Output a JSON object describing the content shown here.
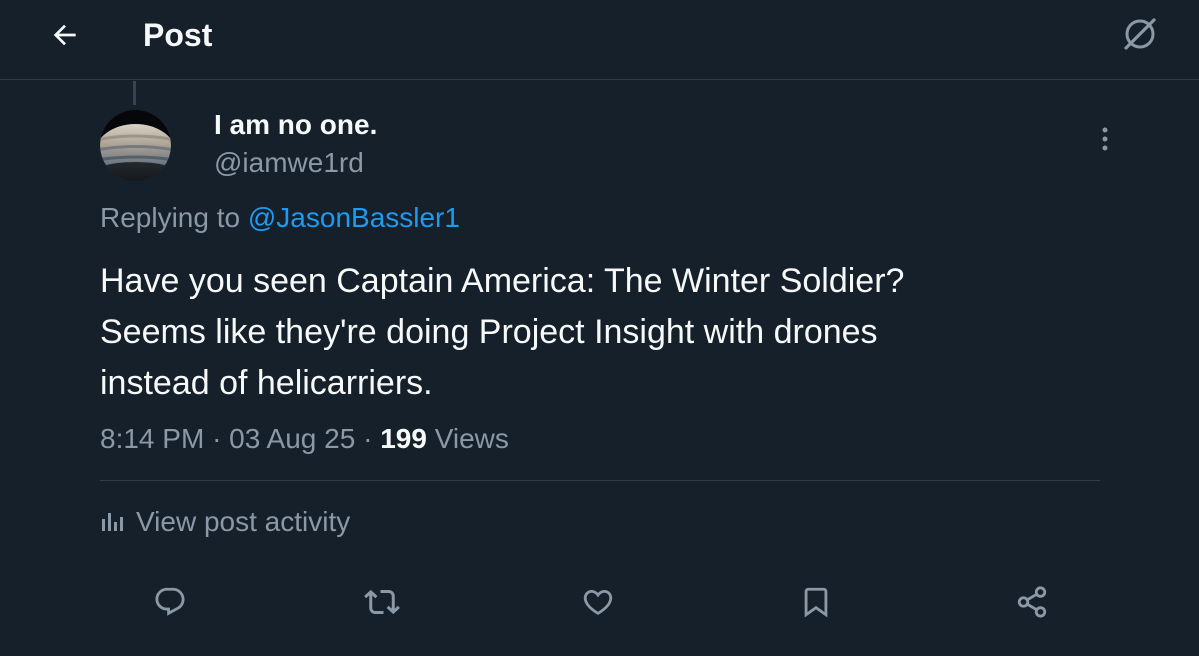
{
  "header": {
    "title": "Post",
    "back_icon": "arrow-left-icon",
    "grok_icon": "grok-icon"
  },
  "author": {
    "name": "I am no one.",
    "handle": "@iamwe1rd",
    "avatar_icon": "planet-avatar"
  },
  "reply_context": {
    "prefix": "Replying to",
    "mention": "@JasonBassler1"
  },
  "post": {
    "line1": "Have you seen Captain America: The Winter Soldier?",
    "line2": "Seems like they're doing Project Insight with drones",
    "line3": "instead of helicarriers."
  },
  "meta": {
    "time": "8:14 PM",
    "date": "03 Aug 25",
    "separator": "·",
    "views_count": "199",
    "views_label": "Views"
  },
  "activity": {
    "label": "View post activity",
    "icon": "bar-chart-icon"
  },
  "actions": [
    {
      "name": "reply",
      "icon": "reply-icon"
    },
    {
      "name": "repost",
      "icon": "repost-icon"
    },
    {
      "name": "like",
      "icon": "heart-icon"
    },
    {
      "name": "bookmark",
      "icon": "bookmark-icon"
    },
    {
      "name": "share",
      "icon": "share-icon"
    }
  ],
  "colors": {
    "background": "#15202b",
    "primary_text": "#f7f9f9",
    "secondary_text": "#8b98a5",
    "accent": "#1d9bf0",
    "divider": "#2f3b47"
  }
}
